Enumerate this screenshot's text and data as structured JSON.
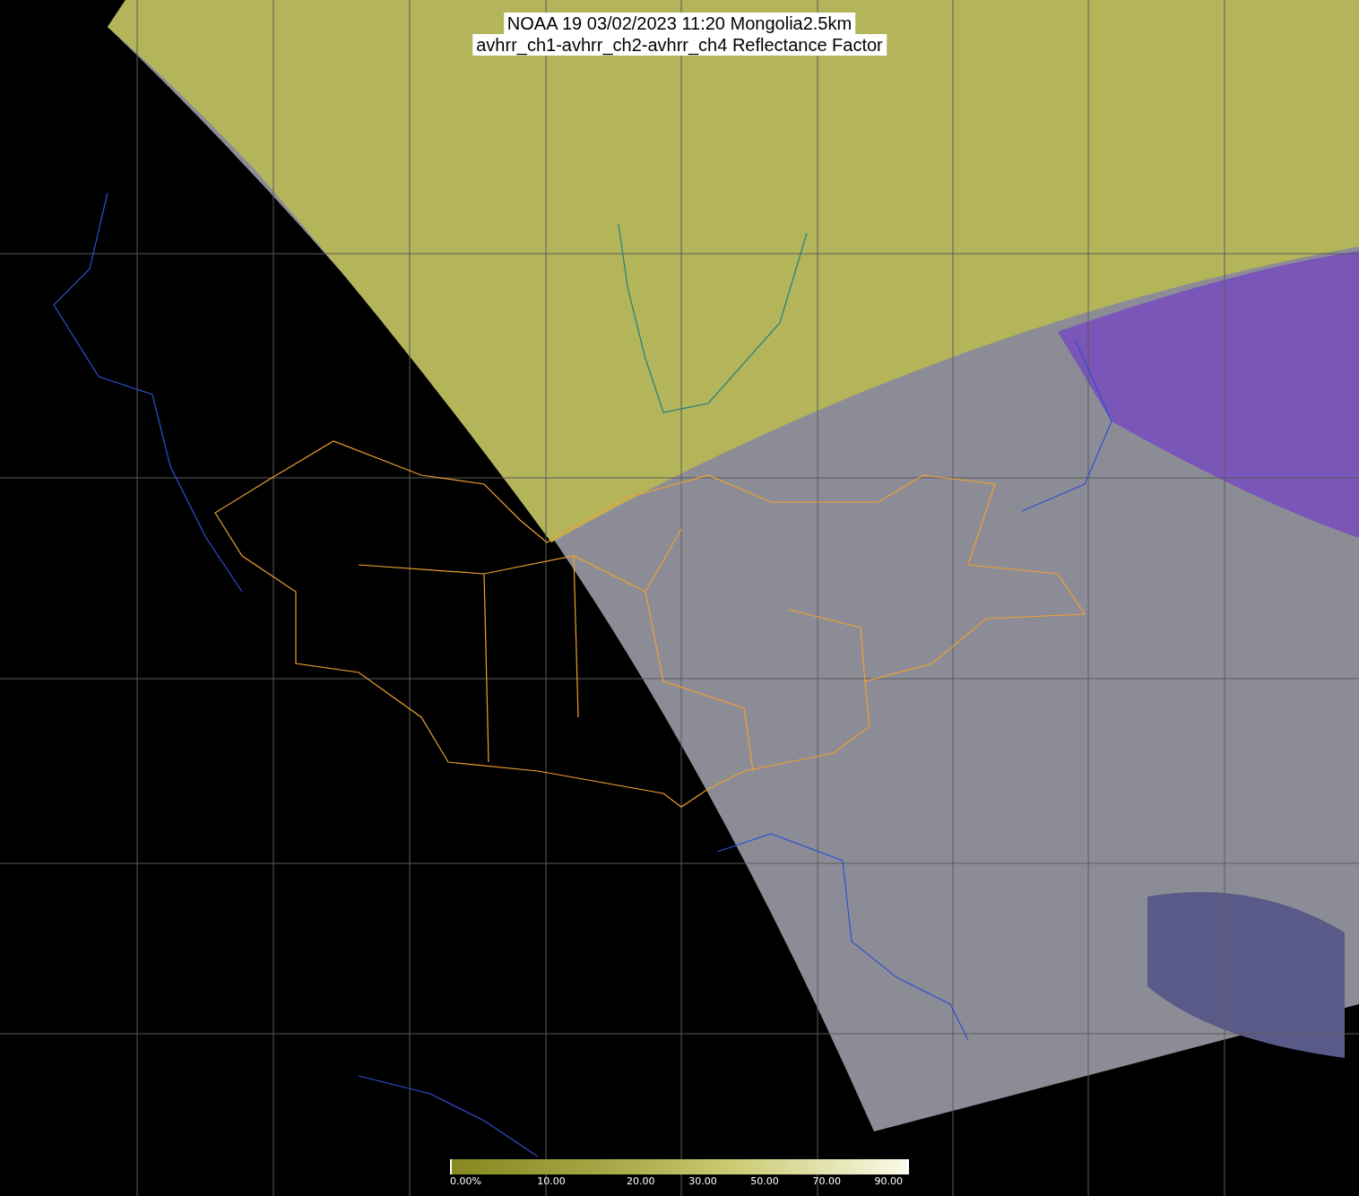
{
  "title": {
    "lines": [
      "NOAA 19 03/02/2023 11:20 Mongolia2.5km",
      "avhrr_ch1-avhrr_ch2-avhrr_ch4 Reflectance Factor"
    ]
  },
  "colorbar": {
    "labels": [
      "0.00%",
      "10.00",
      "20.00",
      "30.00",
      "50.00",
      "70.00",
      "90.00"
    ]
  }
}
